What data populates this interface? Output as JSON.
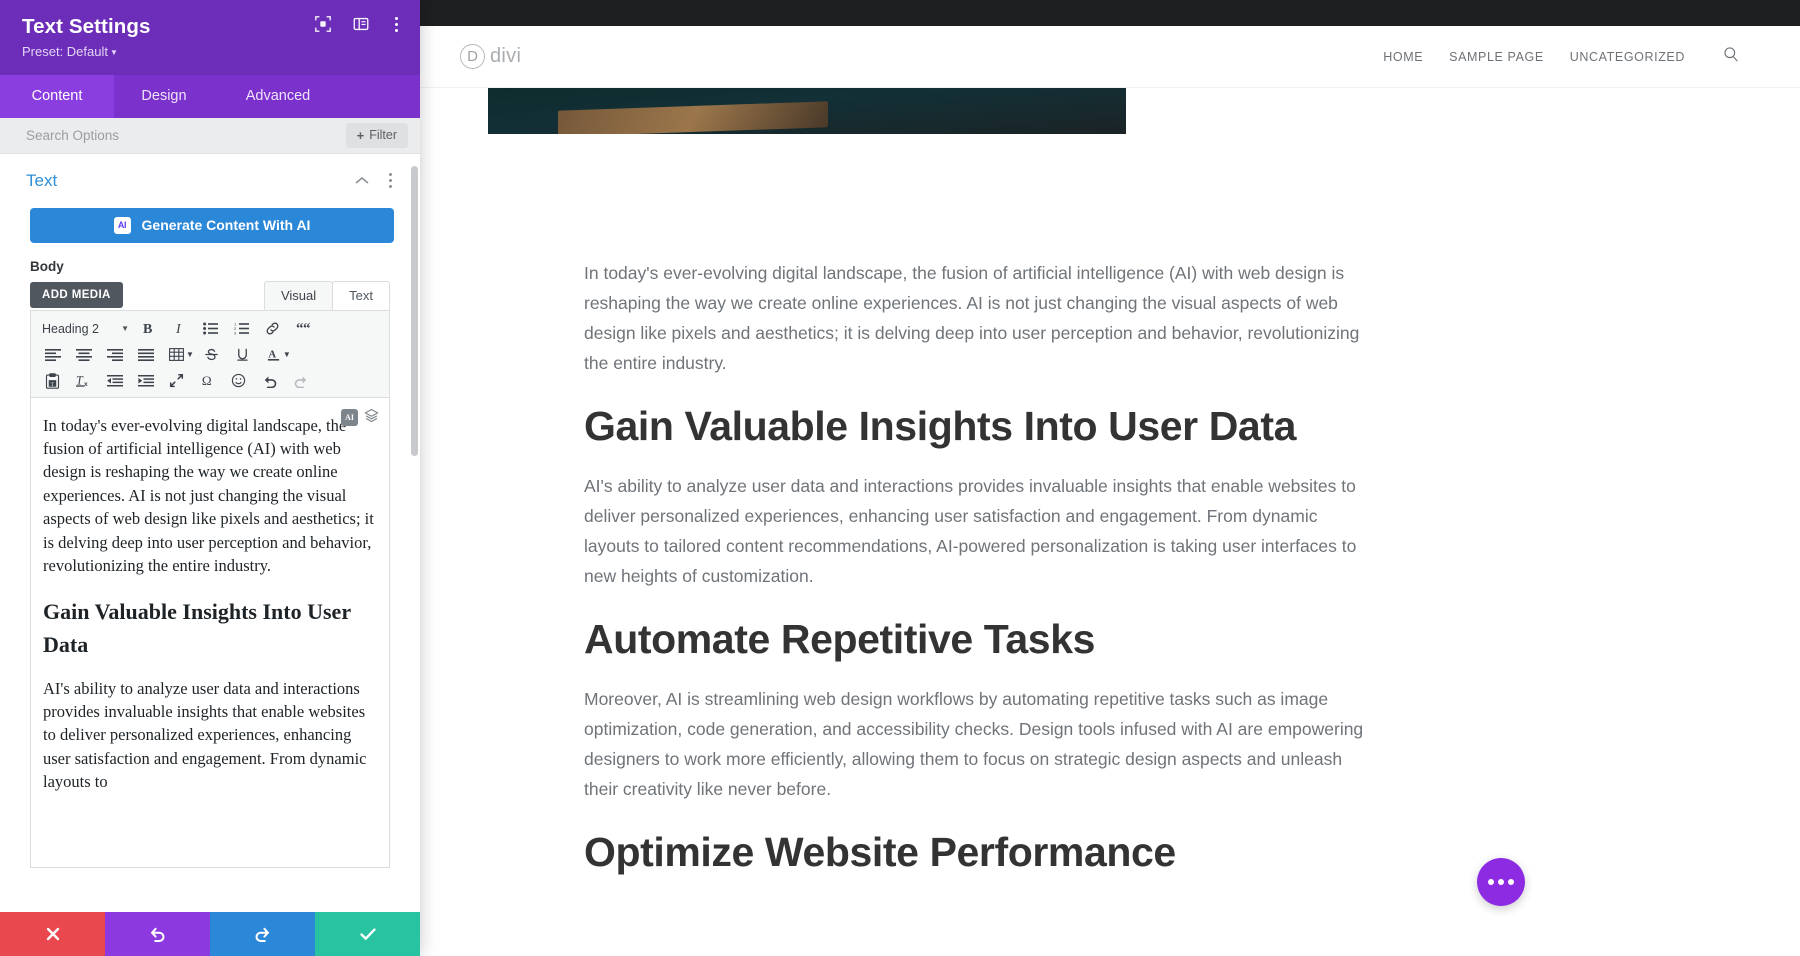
{
  "panel": {
    "title": "Text Settings",
    "preset": "Preset: Default",
    "header_icons": [
      "target-focus-icon",
      "layout-panel-icon",
      "more-vertical-icon"
    ],
    "tabs": [
      {
        "label": "Content",
        "active": true
      },
      {
        "label": "Design",
        "active": false
      },
      {
        "label": "Advanced",
        "active": false
      }
    ],
    "search_placeholder": "Search Options",
    "filter_label": "Filter",
    "section": {
      "title": "Text",
      "collapse_icon": "chevron-up-icon",
      "menu_icon": "more-vertical-icon"
    },
    "ai_button": {
      "label": "Generate Content With AI",
      "badge": "AI",
      "color": "#2b87d8"
    },
    "body_label": "Body",
    "editor": {
      "add_media_label": "ADD MEDIA",
      "mode_tabs": [
        {
          "label": "Visual",
          "active": true
        },
        {
          "label": "Text",
          "active": false
        }
      ],
      "format_select": "Heading 2",
      "toolbar_row1": [
        "bold-icon",
        "italic-icon",
        "bulleted-list-icon",
        "numbered-list-icon",
        "link-icon",
        "blockquote-icon"
      ],
      "toolbar_row2": [
        "align-left-icon",
        "align-center-icon",
        "align-right-icon",
        "align-justify-icon",
        "table-icon",
        "strikethrough-icon",
        "underline-icon",
        "text-color-icon"
      ],
      "toolbar_row3": [
        "paste-as-text-icon",
        "clear-formatting-icon",
        "outdent-icon",
        "indent-icon",
        "fullscreen-icon",
        "special-character-icon",
        "emoji-icon",
        "undo-icon",
        "redo-icon"
      ],
      "content": {
        "paragraph1": "In today's ever-evolving digital landscape, the fusion of artificial intelligence (AI) with web design is reshaping the way we create online experiences. AI is not just changing the visual aspects of web design like pixels and aesthetics; it is delving deep into user perception and behavior, revolutionizing the entire industry.",
        "heading1": "Gain Valuable Insights Into User Data",
        "paragraph2": "AI's ability to analyze user data and interactions provides invaluable insights that enable websites to deliver personalized experiences, enhancing user satisfaction and engagement. From dynamic layouts to"
      },
      "floating": {
        "ai_badge": "AI",
        "layers_icon": "layers-icon"
      }
    },
    "footer_buttons": [
      {
        "name": "cancel",
        "icon": "close-icon",
        "color": "#e8484e"
      },
      {
        "name": "undo",
        "icon": "undo-icon",
        "color": "#8d39e0"
      },
      {
        "name": "redo",
        "icon": "redo-icon",
        "color": "#2b87d8"
      },
      {
        "name": "save",
        "icon": "check-icon",
        "color": "#28c3a0"
      }
    ]
  },
  "preview": {
    "site": {
      "logo_letter": "D",
      "logo_text": "divi",
      "nav": [
        "HOME",
        "SAMPLE PAGE",
        "UNCATEGORIZED"
      ],
      "search_icon": "search-icon"
    },
    "article": {
      "paragraph1": "In today's ever-evolving digital landscape, the fusion of artificial intelligence (AI) with web design is reshaping the way we create online experiences. AI is not just changing the visual aspects of web design like pixels and aesthetics; it is delving deep into user perception and behavior, revolutionizing the entire industry.",
      "heading1": "Gain Valuable Insights Into User Data",
      "paragraph2": "AI's ability to analyze user data and interactions provides invaluable insights that enable websites to deliver personalized experiences, enhancing user satisfaction and engagement. From dynamic layouts to tailored content recommendations, AI-powered personalization is taking user interfaces to new heights of customization.",
      "heading2": "Automate Repetitive Tasks",
      "paragraph3": "Moreover, AI is streamlining web design workflows by automating repetitive tasks such as image optimization, code generation, and accessibility checks. Design tools infused with AI are empowering designers to work more efficiently, allowing them to focus on strategic design aspects and unleash their creativity like never before.",
      "heading3": "Optimize Website Performance"
    },
    "chat_fab": {
      "icon": "chat-dots-icon",
      "color": "#8d2be2"
    }
  }
}
